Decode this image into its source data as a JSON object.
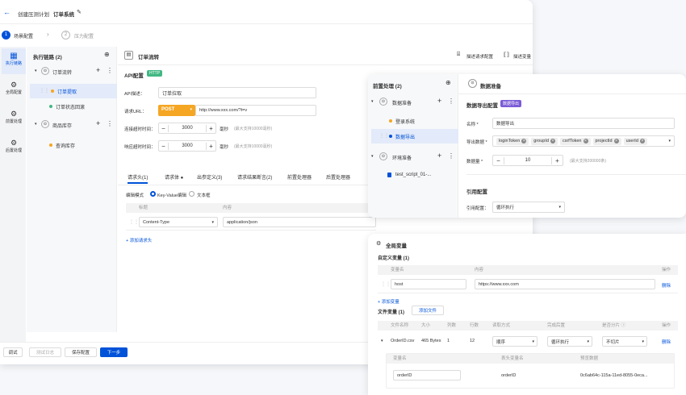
{
  "app": {
    "back": "←",
    "title": "创建压测计划",
    "subtitle": "订单系统",
    "edit_icon": "✎"
  },
  "steps": [
    {
      "num": "1",
      "label": "场景配置"
    },
    {
      "num": "2",
      "label": "压力配置"
    }
  ],
  "leftnav": [
    {
      "label": "执行链路"
    },
    {
      "label": "全局配置"
    },
    {
      "label": "前置处理"
    },
    {
      "label": "后置处理"
    }
  ],
  "chain": {
    "title": "执行链路 (2)",
    "groups": [
      {
        "name": "订单流转",
        "items": [
          {
            "label": "订单提取",
            "selected": true,
            "dot": "#f5a623"
          },
          {
            "label": "订单状态回滚",
            "dot": "#41b883"
          }
        ]
      },
      {
        "name": "商品库存",
        "items": [
          {
            "label": "查询库存",
            "dot": "#f5a623"
          }
        ]
      }
    ]
  },
  "main": {
    "title": "订单流转",
    "actions": [
      {
        "label": "描述请求配置"
      },
      {
        "label": "描述变量"
      }
    ],
    "api_label": "API配置",
    "api_badge": "HTTP",
    "fields": {
      "name_label": "API描述：",
      "name_value": "订单拉取",
      "url_label": "请求URL：",
      "method": "POST",
      "url": "http://www.xxx.com/?t=v",
      "timeout_label": "连接超时时间：",
      "timeout": "3000",
      "timeout_unit": "毫秒",
      "timeout_hint": "(最大支持10000毫秒)",
      "resp_label": "响应超时时间：",
      "resp": "3000",
      "resp_unit": "毫秒",
      "resp_hint": "(最大支持10000毫秒)"
    },
    "tabs": [
      "请求头(1)",
      "请求体 ●",
      "出参定义(3)",
      "请求结果断言(2)",
      "前置处理器",
      "后置处理器"
    ],
    "mode_label": "编辑模式",
    "mode_kv": "Key-Value编辑",
    "mode_text": "文本框",
    "th": {
      "key": "标题",
      "value": "内容"
    },
    "row": {
      "key": "Content-Type",
      "value": "application/json"
    },
    "add": "+ 添加请求头"
  },
  "footer": {
    "buttons": [
      "调试",
      "测试日志",
      "保存配置",
      "下一步"
    ]
  },
  "pre": {
    "title": "前置处理 (2)",
    "groups": [
      {
        "name": "数据准备",
        "items": [
          {
            "label": "登录系统",
            "dot": "#f5a623"
          },
          {
            "label": "数据导出",
            "dot": "#0052d9",
            "selected": true
          }
        ]
      },
      {
        "name": "环境准备",
        "items": [
          {
            "label": "test_script_01-...",
            "dot": "#0052d9"
          }
        ]
      }
    ],
    "panel_title": "数据准备",
    "section": "数据导出配置",
    "section_badge": "数据导出",
    "name_label": "名称 *",
    "name_value": "数据导出",
    "field_label": "导出数据 *",
    "tags": [
      "loginToken",
      "groupId",
      "csrfToken",
      "projectId",
      "userId"
    ],
    "count_label": "数据量 *",
    "count": "10",
    "count_hint": "(最大支持200000条)",
    "ref_section": "引用配置",
    "ref_label": "引用配置：",
    "ref_value": "循环执行"
  },
  "globalvars": {
    "title": "全局变量",
    "custom": "自定义变量 (1)",
    "cols": {
      "name": "变量名",
      "content": "内容",
      "op": "操作"
    },
    "row": {
      "name": "host",
      "content": "https://www.xxx.com",
      "op": "删除"
    },
    "add": "+ 添加变量",
    "files_title": "文件变量 (1)",
    "upload": "添加文件",
    "fcols": [
      "文件名称",
      "大小",
      "列数",
      "行数",
      "读取方式",
      "完成后置",
      "是否分片 ⓘ",
      "操作"
    ],
    "frow": [
      "OrderID.csv",
      "465 Bytes",
      "1",
      "12",
      "顺序",
      "循环执行",
      "不切片",
      "删除"
    ],
    "subcols": [
      "变量名",
      "表头变量名",
      "预览数据"
    ],
    "subrow": [
      "orderID",
      "orderID",
      "0c6ab64c-115a-11ed-8055-0eca..."
    ]
  }
}
